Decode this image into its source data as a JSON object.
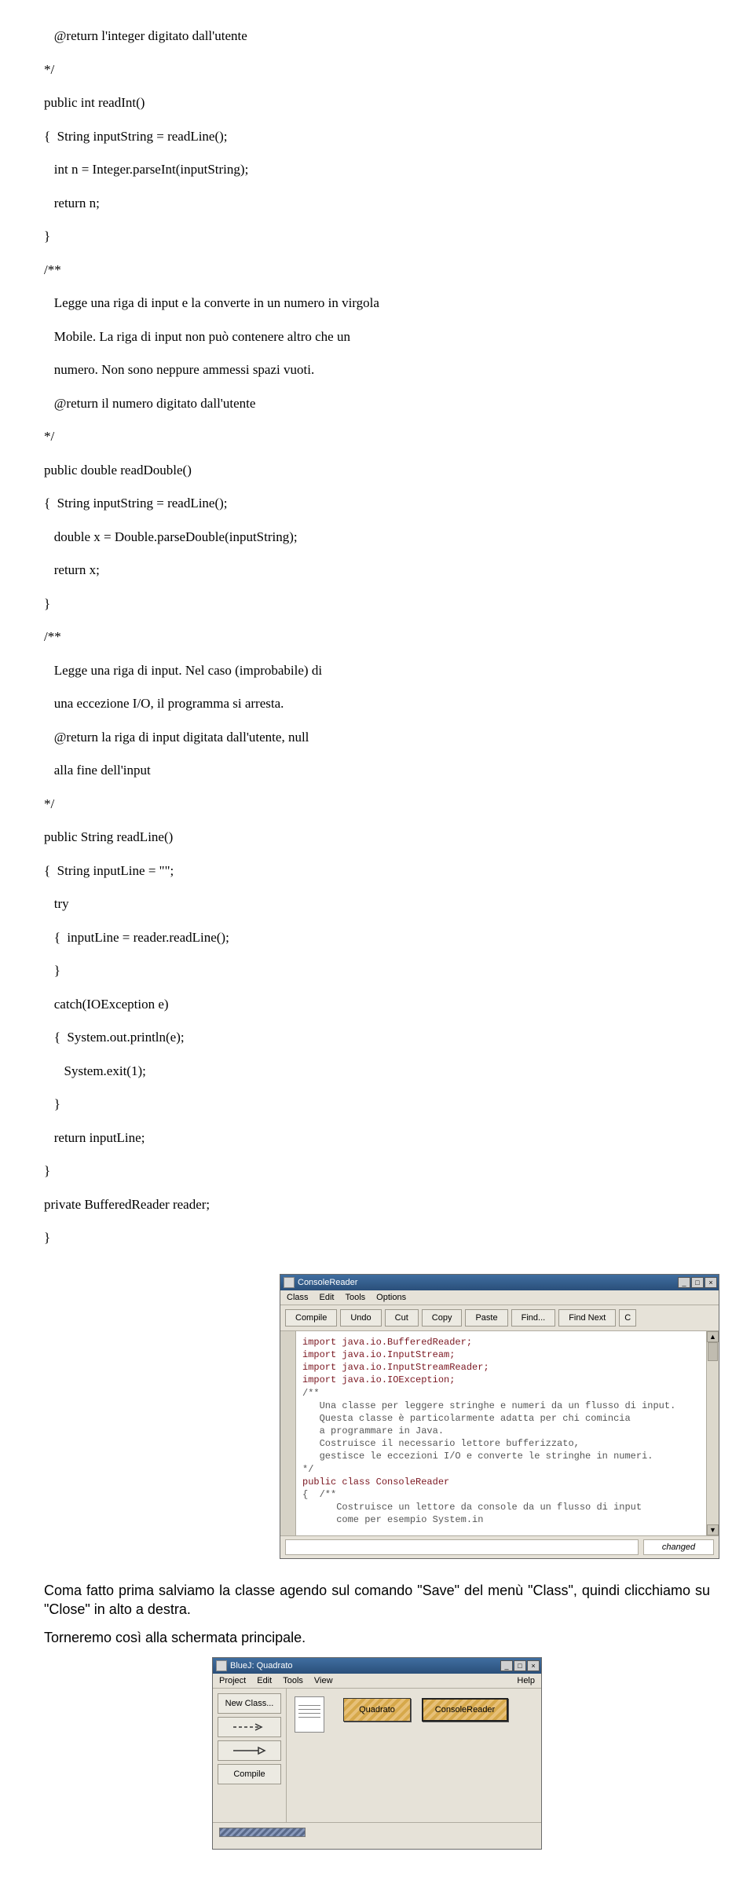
{
  "code": {
    "l1": "   @return l'integer digitato dall'utente",
    "l2": "*/",
    "l3": "public int readInt()",
    "l4": "{  String inputString = readLine();",
    "l5": "   int n = Integer.parseInt(inputString);",
    "l6": "   return n;",
    "l7": "}",
    "l8": "/**",
    "l9": "   Legge una riga di input e la converte in un numero in virgola",
    "l10": "   Mobile. La riga di input non può contenere altro che un",
    "l11": "   numero. Non sono neppure ammessi spazi vuoti.",
    "l12": "   @return il numero digitato dall'utente",
    "l13": "*/",
    "l14": "public double readDouble()",
    "l15": "{  String inputString = readLine();",
    "l16": "   double x = Double.parseDouble(inputString);",
    "l17": "   return x;",
    "l18": "}",
    "l19": "/**",
    "l20": "   Legge una riga di input. Nel caso (improbabile) di",
    "l21": "   una eccezione I/O, il programma si arresta.",
    "l22": "   @return la riga di input digitata dall'utente, null",
    "l23": "   alla fine dell'input",
    "l24": "*/",
    "l25": "public String readLine()",
    "l26": "{  String inputLine = \"\";",
    "l27": "   try",
    "l28": "   {  inputLine = reader.readLine();",
    "l29": "   }",
    "l30": "   catch(IOException e)",
    "l31": "   {  System.out.println(e);",
    "l32": "      System.exit(1);",
    "l33": "   }",
    "l34": "   return inputLine;",
    "l35": "}",
    "l36": "private BufferedReader reader;",
    "l37": "}"
  },
  "ide": {
    "title": "ConsoleReader",
    "menu": {
      "class": "Class",
      "edit": "Edit",
      "tools": "Tools",
      "options": "Options"
    },
    "toolbar": {
      "compile": "Compile",
      "undo": "Undo",
      "cut": "Cut",
      "copy": "Copy",
      "paste": "Paste",
      "find": "Find...",
      "findnext": "Find Next",
      "c": "C"
    },
    "src": {
      "l1": "import java.io.BufferedReader;",
      "l2": "import java.io.InputStream;",
      "l3": "import java.io.InputStreamReader;",
      "l4": "import java.io.IOException;",
      "l5": "",
      "l6": "/**",
      "l7": "   Una classe per leggere stringhe e numeri da un flusso di input.",
      "l8": "   Questa classe è particolarmente adatta per chi comincia",
      "l9": "   a programmare in Java.",
      "l10": "   Costruisce il necessario lettore bufferizzato,",
      "l11": "   gestisce le eccezioni I/O e converte le stringhe in numeri.",
      "l12": "*/",
      "l13": "",
      "l14": "public class ConsoleReader",
      "l15": "{  /**",
      "l16": "      Costruisce un lettore da console da un flusso di input",
      "l17": "      come per esempio System.in"
    },
    "status": "changed"
  },
  "para1": "Coma fatto prima salviamo la classe agendo sul comando \"Save\" del menù \"Class\", quindi clicchiamo su \"Close\" in alto a destra.",
  "para2": "Torneremo così alla schermata principale.",
  "bluej": {
    "title": "BlueJ:  Quadrato",
    "menu": {
      "project": "Project",
      "edit": "Edit",
      "tools": "Tools",
      "view": "View",
      "help": "Help"
    },
    "side": {
      "newclass": "New Class...",
      "compile": "Compile"
    },
    "class1": "Quadrato",
    "class2": "ConsoleReader"
  }
}
